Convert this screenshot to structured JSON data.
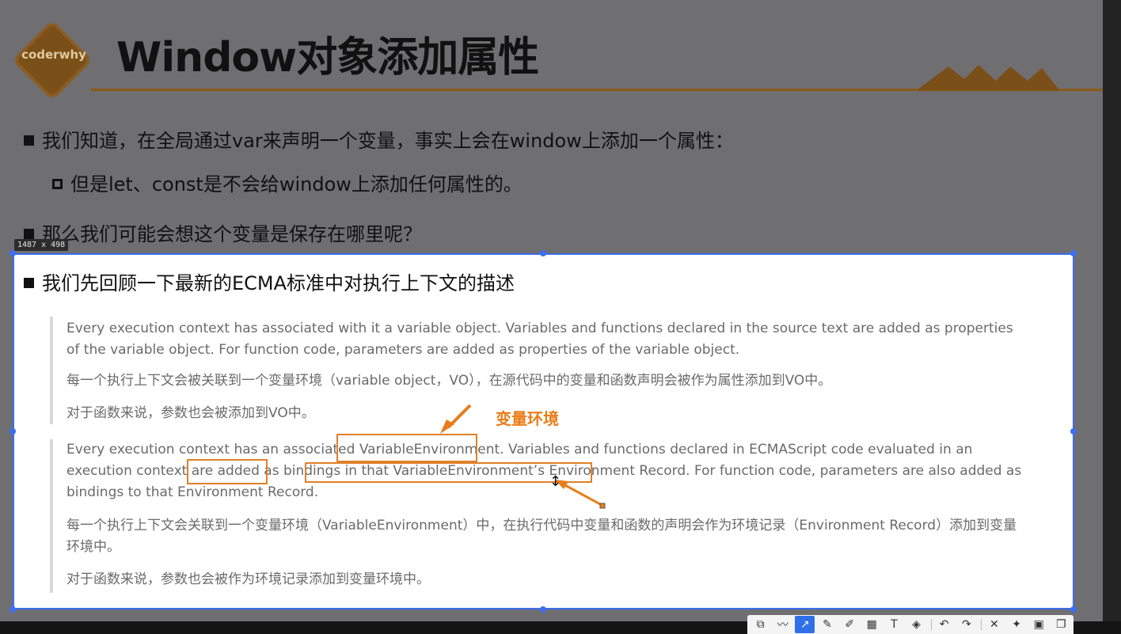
{
  "slide": {
    "logo_text": "coderwhy",
    "title": "Window对象添加属性",
    "bullets": [
      "我们知道，在全局通过var来声明一个变量，事实上会在window上添加一个属性：",
      "但是let、const是不会给window上添加任何属性的。",
      "那么我们可能会想这个变量是保存在哪里呢？",
      "我们先回顾一下最新的ECMA标准中对执行上下文的描述"
    ],
    "accent_color": "#8a5a15"
  },
  "selection": {
    "size_label": "1487 x 498",
    "border_color": "#3d6ff0"
  },
  "quote1": {
    "en": "Every execution context has associated with it a variable object. Variables and functions declared in the source text are added as properties of the variable object. For function code, parameters are added as properties of the variable object.",
    "zh1": "每一个执行上下文会被关联到一个变量环境（variable object，VO），在源代码中的变量和函数声明会被作为属性添加到VO中。",
    "zh2": "对于函数来说，参数也会被添加到VO中。"
  },
  "quote2": {
    "en": "Every execution context has an associated VariableEnvironment. Variables and functions declared in ECMAScript code evaluated in an execution context are added as bindings in that VariableEnvironment’s Environment Record. For function code, parameters are also added as bindings to that Environment Record.",
    "zh1": "每一个执行上下文会关联到一个变量环境（VariableEnvironment）中，在执行代码中变量和函数的声明会作为环境记录（Environment Record）添加到变量环境中。",
    "zh2": "对于函数来说，参数也会被作为环境记录添加到变量环境中。"
  },
  "annotation": {
    "label": "变量环境",
    "color": "#e97d18"
  },
  "toolbar": {
    "tools": [
      {
        "name": "rect-select-icon",
        "glyph": "⧉"
      },
      {
        "name": "curve-icon",
        "glyph": "〰"
      },
      {
        "name": "arrow-icon",
        "glyph": "↗",
        "active": true
      },
      {
        "name": "pen-icon",
        "glyph": "✎"
      },
      {
        "name": "marker-icon",
        "glyph": "✐"
      },
      {
        "name": "mosaic-icon",
        "glyph": "▦"
      },
      {
        "name": "text-icon",
        "glyph": "T"
      },
      {
        "name": "eraser-icon",
        "glyph": "◈"
      },
      {
        "name": "undo-icon",
        "glyph": "↶"
      },
      {
        "name": "redo-icon",
        "glyph": "↷"
      },
      {
        "name": "close-icon",
        "glyph": "✕"
      },
      {
        "name": "pin-icon",
        "glyph": "✦"
      },
      {
        "name": "save-icon",
        "glyph": "▣"
      },
      {
        "name": "copy-icon",
        "glyph": "❐"
      }
    ]
  }
}
